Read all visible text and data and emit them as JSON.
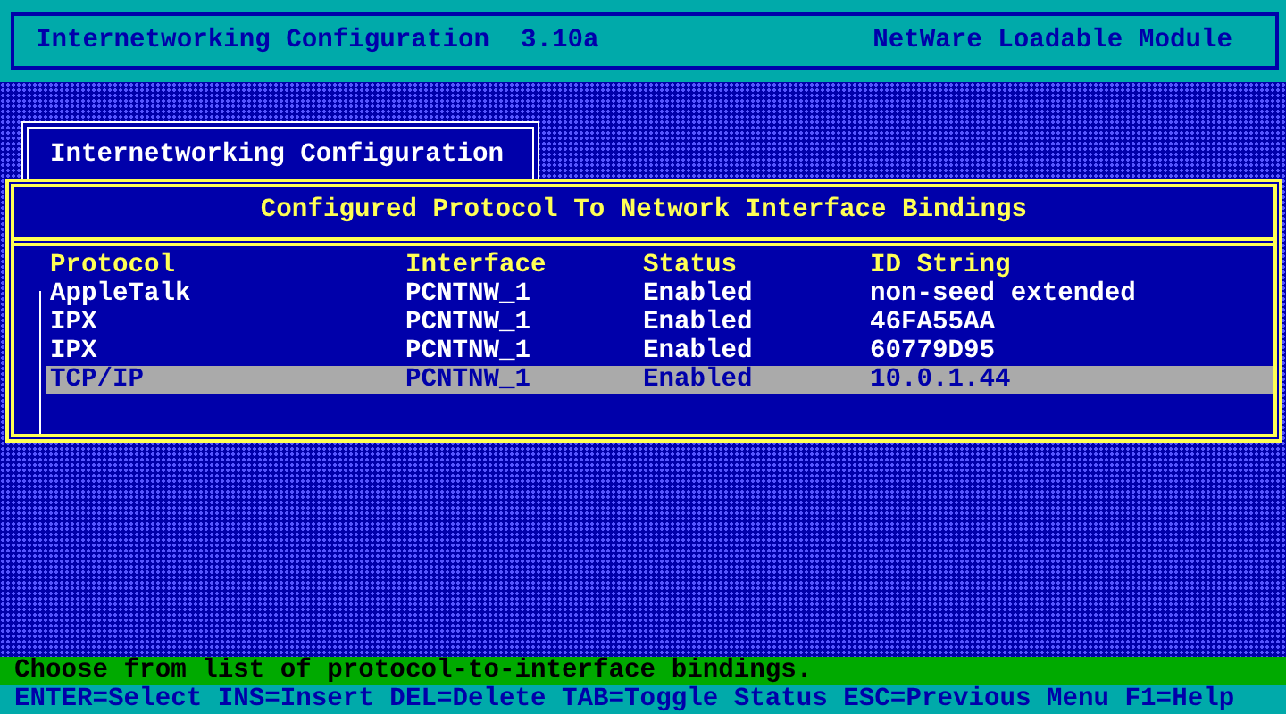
{
  "header": {
    "title": "Internetworking Configuration  3.10a",
    "module": "NetWare Loadable Module"
  },
  "menu": {
    "title": "Internetworking Configuration"
  },
  "panel": {
    "title": "Configured Protocol To Network Interface Bindings",
    "columns": [
      "Protocol",
      "Interface",
      "Status",
      "ID String"
    ],
    "rows": [
      {
        "cells": [
          "AppleTalk",
          "PCNTNW_1",
          "Enabled",
          "non-seed extended"
        ],
        "selected": false
      },
      {
        "cells": [
          "IPX",
          "PCNTNW_1",
          "Enabled",
          "46FA55AA"
        ],
        "selected": false
      },
      {
        "cells": [
          "IPX",
          "PCNTNW_1",
          "Enabled",
          "60779D95"
        ],
        "selected": false
      },
      {
        "cells": [
          "TCP/IP",
          "PCNTNW_1",
          "Enabled",
          "10.0.1.44"
        ],
        "selected": true
      }
    ]
  },
  "status_line": "Choose from list of protocol-to-interface bindings.",
  "key_help": "ENTER=Select INS=Insert DEL=Delete TAB=Toggle Status ESC=Previous Menu F1=Help"
}
